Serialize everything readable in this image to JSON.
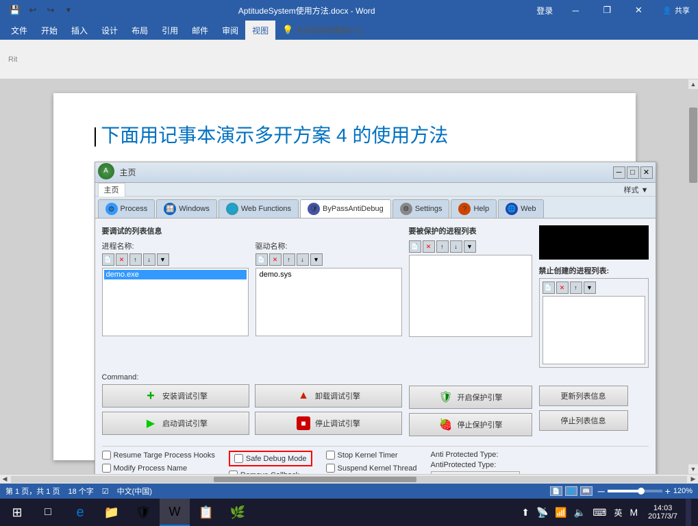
{
  "window": {
    "title": "AptitudeSystem使用方法.docx - Word",
    "login": "登录",
    "share": "共享"
  },
  "titlebar": {
    "controls": {
      "minimize": "─",
      "maximize": "□",
      "restore": "❐",
      "close": "✕"
    }
  },
  "quick_access": [
    "💾",
    "↩",
    "↪",
    "✦"
  ],
  "ribbon": {
    "tabs": [
      "文件",
      "开始",
      "插入",
      "设计",
      "布局",
      "引用",
      "邮件",
      "审阅",
      "视图"
    ],
    "active_tab": "开始",
    "tell_me": "告诉我你想要做什么"
  },
  "doc": {
    "heading": "下面用记事本演示多开方案 4 的使用方法",
    "cursor_after": true
  },
  "apt_window": {
    "title": "主页",
    "style_btn": "样式 ▼",
    "tabs": [
      "Process",
      "Windows",
      "Web Functions",
      "ByPassAntiDebug",
      "Settings",
      "Help",
      "Web"
    ],
    "active_tab": "ByPassAntiDebug",
    "sections": {
      "test_list": "要调试的列表信息",
      "process_label": "进程名称:",
      "driver_label": "驱动名称:",
      "protect_list": "要被保护的进程列表",
      "no_create_list": "禁止创建的进程列表:"
    },
    "list_items": {
      "process": [
        "demo.exe"
      ],
      "driver": [
        "demo.sys"
      ]
    },
    "command": "Command:",
    "buttons": {
      "install_debug": "安装调试引擎",
      "unload_debug": "卸载调试引擎",
      "start_debug": "启动调试引擎",
      "stop_debug": "停止调试引擎",
      "start_protect": "开启保护引擎",
      "stop_protect": "停止保护引擎",
      "update_list": "更新列表信息",
      "stop_list": "停止列表信息"
    },
    "checkboxes": {
      "resume_hooks": "Resume Targe Process Hooks",
      "modify_name": "Modify Process Name",
      "safe_debug": "Safe Debug Mode",
      "stop_kernel": "Stop Kernel Timer",
      "remove_callback": "Remove Callback",
      "suspend_thread": "Suspend Kernel Thread"
    },
    "anti_protected": {
      "title": "Anti Protected Type:",
      "label": "AntiProtected Type:"
    }
  },
  "statusbar": {
    "page": "第 1 页，共 1 页",
    "chars": "18 个字",
    "spell": "☑",
    "lang": "中文(中国)",
    "zoom": "120%"
  },
  "taskbar": {
    "time": "14:03",
    "date": "2017/3/7",
    "lang": "英",
    "apps": [
      "⊞",
      "□",
      "e",
      "📁",
      "🛡",
      "W",
      "📋",
      "🌿"
    ]
  }
}
